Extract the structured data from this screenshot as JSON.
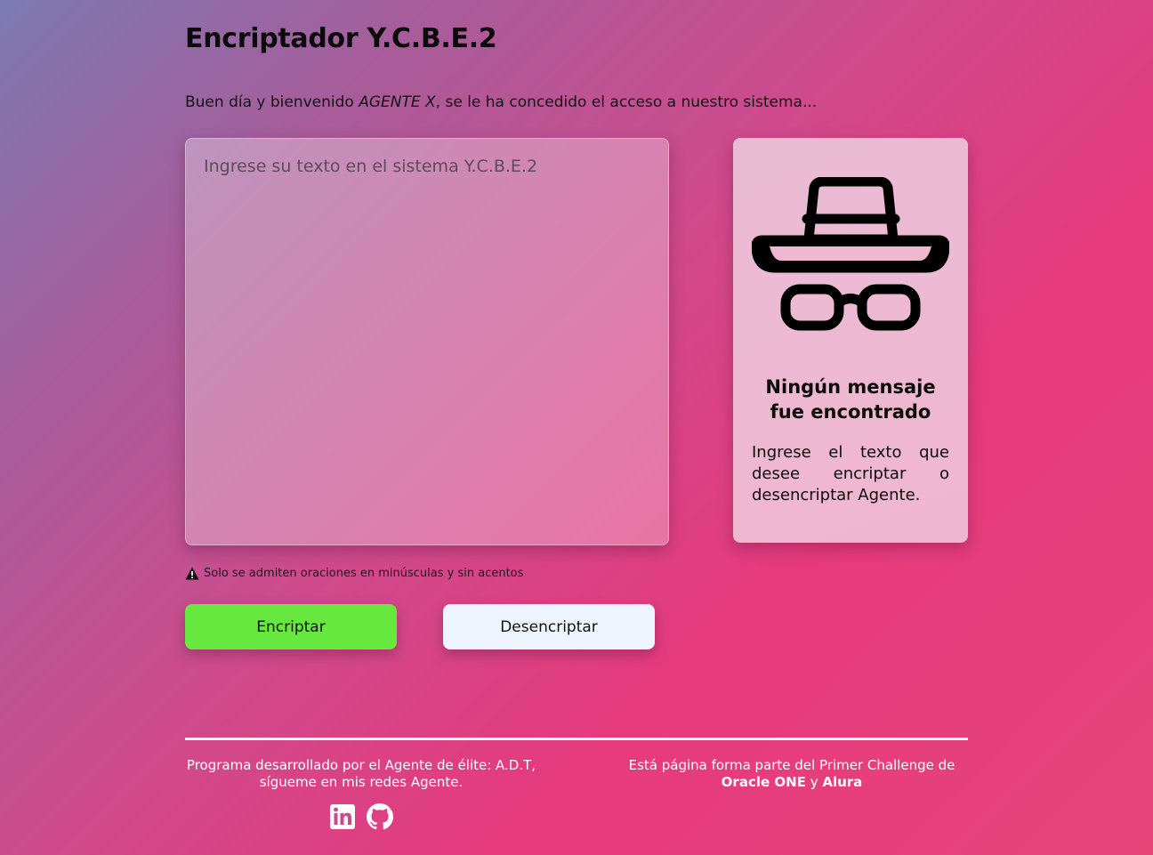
{
  "header": {
    "title": "Encriptador Y.C.B.E.2",
    "welcome_prefix": "Buen día y bienvenido ",
    "welcome_agent": "AGENTE X",
    "welcome_suffix": ", se le ha concedido el acceso a nuestro sistema..."
  },
  "input": {
    "placeholder": "Ingrese su texto en el sistema Y.C.B.E.2",
    "value": ""
  },
  "result": {
    "icon": "incognito-agent-icon",
    "title": "Ningún mensaje fue encontrado",
    "text": "Ingrese el texto que desee encriptar o desencriptar Agente."
  },
  "warning": {
    "icon": "warning-triangle-icon",
    "text": "Solo se admiten oraciones en minúsculas y sin acentos"
  },
  "buttons": {
    "encrypt_label": "Encriptar",
    "decrypt_label": "Desencriptar"
  },
  "footer": {
    "left_line1": "Programa desarrollado por el Agente de élite: A.D.T,",
    "left_line2": "sígueme en mis redes Agente.",
    "right_line1": "Está página forma parte del Primer Challenge de",
    "right_oracle": "Oracle ONE",
    "right_and": " y ",
    "right_alura": "Alura",
    "social": [
      "linkedin-icon",
      "github-icon"
    ]
  },
  "colors": {
    "encrypt_button": "#66e83e",
    "decrypt_button": "#eef5ff",
    "card_background": "#efb8d1"
  }
}
